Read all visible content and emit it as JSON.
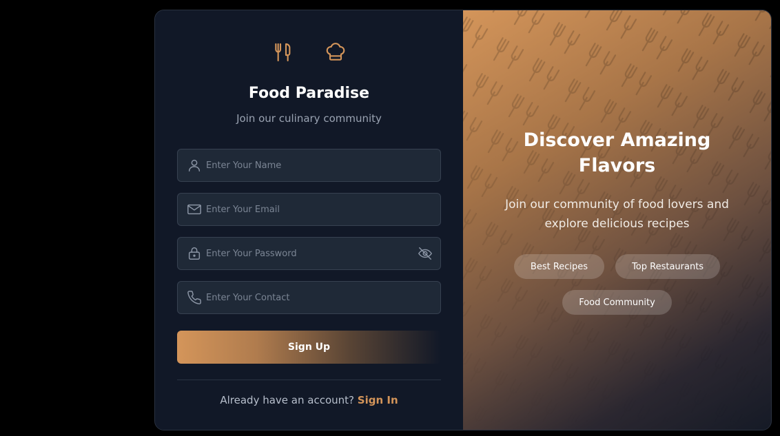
{
  "brand": {
    "title": "Food Paradise",
    "subtitle": "Join our culinary community",
    "icons": [
      "utensils-icon",
      "chef-hat-icon"
    ]
  },
  "form": {
    "name_placeholder": "Enter Your Name",
    "email_placeholder": "Enter Your Email",
    "password_placeholder": "Enter Your Password",
    "contact_placeholder": "Enter Your Contact",
    "submit_label": "Sign Up"
  },
  "footer": {
    "prompt": "Already have an account?",
    "link_label": "Sign In"
  },
  "hero": {
    "title": "Discover Amazing Flavors",
    "subtitle": "Join our community of food lovers and explore delicious recipes",
    "chips": [
      "Best Recipes",
      "Top Restaurants",
      "Food Community"
    ]
  },
  "colors": {
    "accent": "#d4955a",
    "panel_bg": "#111827",
    "field_bg": "#1f2937"
  }
}
